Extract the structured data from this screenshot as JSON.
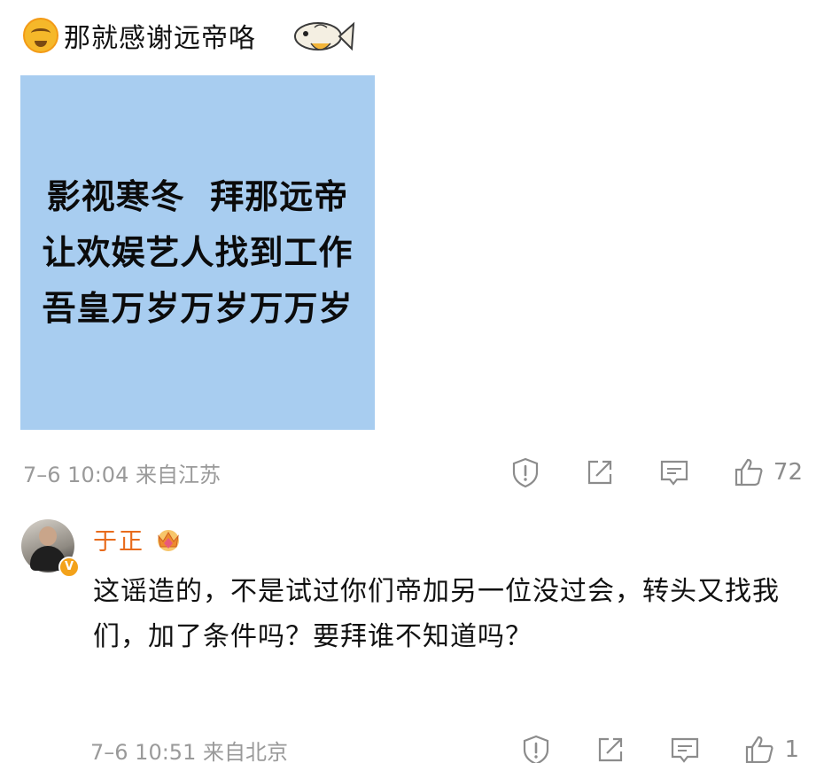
{
  "comment_1": {
    "text": "那就感谢远帝咯",
    "emoji_icon": "dizzy-face-emoji",
    "sticker_icon": "fish-sticker",
    "image_lines": [
      "影视寒冬  拜那远帝",
      "让欢娱艺人找到工作",
      "吾皇万岁万岁万万岁"
    ],
    "image_background": "#a8cdf0",
    "meta": "7–6 10:04  来自江苏",
    "like_count": "72"
  },
  "comment_2": {
    "author": "于正",
    "avatar_badge": "V",
    "author_color": "#e86b1c",
    "text": "这谣造的，不是试过你们帝加另一位没过会，转头又找我们，加了条件吗？要拜谁不知道吗？",
    "meta": "7–6 10:51  来自北京",
    "like_count": "1"
  },
  "actions": {
    "icons": [
      "report-icon",
      "share-icon",
      "reply-icon",
      "like-icon"
    ]
  }
}
